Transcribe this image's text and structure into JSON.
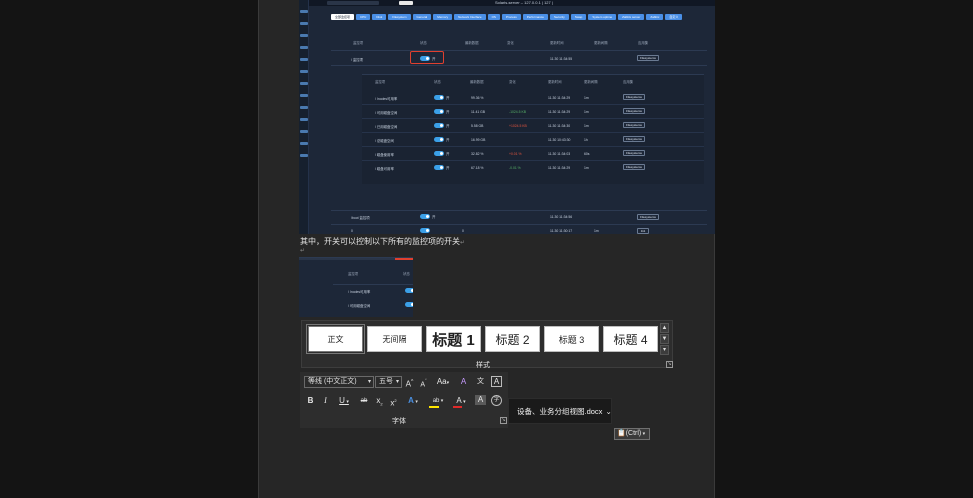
{
  "screenshot1": {
    "window_title": "Solaris-server – 127.0.0.1 | 127 |",
    "search_button": "搜索",
    "tabs": [
      "全部监控项",
      "CPU",
      "Disk",
      "Filesystem",
      "General",
      "Memory",
      "Network Interface",
      "OS",
      "Process",
      "Performance",
      "Security",
      "Swap",
      "System uptime",
      "Zabbix server",
      "Zabbix",
      "自定义"
    ],
    "active_tab_index": 0,
    "columns": [
      "监控项",
      "状态",
      "最新数据",
      "变化",
      "更新时间",
      "更新间隔",
      "应用集"
    ],
    "row_main": {
      "name": "/ 监控项",
      "state": "开",
      "time": "11.30 11:34:55",
      "app": "Filesystems"
    },
    "sub_rows": [
      {
        "name": "/ Inodes可用率",
        "state": "开",
        "value": "99.36 %",
        "change": "",
        "time": "11.30 11:34:29",
        "interval": "1m",
        "app": "Filesystems"
      },
      {
        "name": "/ 可用磁盘空间",
        "state": "开",
        "value": "11.41 GB",
        "change": "-1024.5 KB",
        "time": "11.30 11:34:29",
        "interval": "1m",
        "app": "Filesystems"
      },
      {
        "name": "/ 已用磁盘空间",
        "state": "开",
        "value": "5.58 GB",
        "change": "+1024.5 KB",
        "time": "11.30 11:34:30",
        "interval": "1m",
        "app": "Filesystems"
      },
      {
        "name": "/ 总磁盘空间",
        "state": "开",
        "value": "16.99 GB",
        "change": "",
        "time": "11.30 10:43:30",
        "interval": "1h",
        "app": "Filesystems"
      },
      {
        "name": "/ 磁盘使用率",
        "state": "开",
        "value": "32.82 %",
        "change": "+0.01 %",
        "time": "11.30 11:34:03",
        "interval": "60s",
        "app": "Filesystems"
      },
      {
        "name": "/ 磁盘可用率",
        "state": "开",
        "value": "67.18 %",
        "change": "-0.01 %",
        "time": "11.30 11:34:29",
        "interval": "1m",
        "app": "Filesystems"
      }
    ],
    "row_boot": {
      "name": "/boot 监控项",
      "state": "开",
      "time": "11.30 11:34:56",
      "app": "Filesystems"
    },
    "row_last": {
      "name": "0",
      "state": "",
      "value": "0",
      "time": "11.30 11:30:17",
      "interval": "1m",
      "app": "111"
    }
  },
  "paragraph": "其中，开关可以控制以下所有的监控项的开关",
  "pilcrow": "↵",
  "screenshot2": {
    "columns": [
      "监控项",
      "状态"
    ],
    "rows": [
      "/ Inodes可用率",
      "/ 可用磁盘空间"
    ]
  },
  "styles": {
    "items": [
      "正文",
      "无间隔",
      "标题 1",
      "标题 2",
      "标题 3",
      "标题 4"
    ],
    "group_label": "样式"
  },
  "font": {
    "family": "等线 (中文正文)",
    "size": "五号",
    "group_label": "字体",
    "icons": {
      "grow": "A",
      "shrink": "A",
      "case": "Aa",
      "clear": "A",
      "phonetic": "文",
      "border": "A",
      "bold": "B",
      "italic": "I",
      "underline": "U",
      "strike": "ab",
      "subscript": "x",
      "superscript": "x",
      "effects": "A",
      "highlight": "ab",
      "color": "A",
      "shading": "A",
      "enclose": "字"
    },
    "colors": {
      "effects": "#4a90e2",
      "highlight": "#ffe600",
      "font_color": "#e02a2a"
    }
  },
  "tooltip": "设备、业务分组视图.docx",
  "paste_options": "(Ctrl)"
}
